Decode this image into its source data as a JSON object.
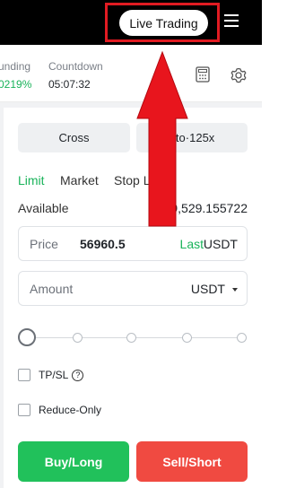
{
  "header": {
    "live_trading_label": "Live Trading"
  },
  "info": {
    "funding_label": "unding",
    "funding_value": "0219%",
    "countdown_label": "Countdown",
    "countdown_value": "05:07:32"
  },
  "controls": {
    "margin_mode": "Cross",
    "leverage_label": "uto·125x"
  },
  "order_tabs": {
    "limit": "Limit",
    "market": "Market",
    "stop": "Stop Li"
  },
  "available": {
    "label": "Available",
    "value": "9,529.155722"
  },
  "price_field": {
    "label": "Price",
    "value": "56960.5",
    "last": "Last",
    "unit": "USDT"
  },
  "amount_field": {
    "label": "Amount",
    "unit": "USDT"
  },
  "slider": {
    "value_percent": 0
  },
  "options": {
    "tpsl": "TP/SL",
    "reduce_only": "Reduce-Only"
  },
  "actions": {
    "buy": "Buy/Long",
    "sell": "Sell/Short"
  },
  "colors": {
    "accent_green": "#19b35a",
    "buy": "#21c15b",
    "sell": "#f04a41",
    "annotation": "#e11b22"
  },
  "icons": {
    "menu": "menu-icon",
    "calculator": "calculator-icon",
    "settings": "gear-icon",
    "help": "help-icon",
    "annotation_arrow": "arrow-up-icon"
  }
}
